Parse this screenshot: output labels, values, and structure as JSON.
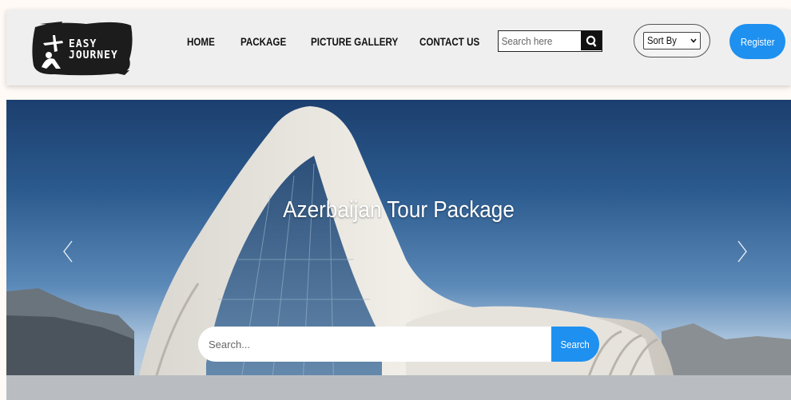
{
  "brand": {
    "line1": "EASY",
    "line2": "JOURNEY"
  },
  "nav": {
    "home": "HOME",
    "package": "PACKAGE",
    "gallery": "PICTURE GALLERY",
    "contact": "CONTACT US"
  },
  "header_search": {
    "placeholder": "Search here",
    "icon": "search-icon"
  },
  "sort": {
    "selected": "Sort By",
    "icon": "chevron-down-icon"
  },
  "register": {
    "label": "Register"
  },
  "hero": {
    "title": "Azerbaijan Tour Package",
    "prev_icon": "chevron-left-icon",
    "next_icon": "chevron-right-icon",
    "search_placeholder": "Search...",
    "search_button": "Search"
  },
  "colors": {
    "accent": "#1e90f0",
    "header_bg": "#efefef"
  }
}
